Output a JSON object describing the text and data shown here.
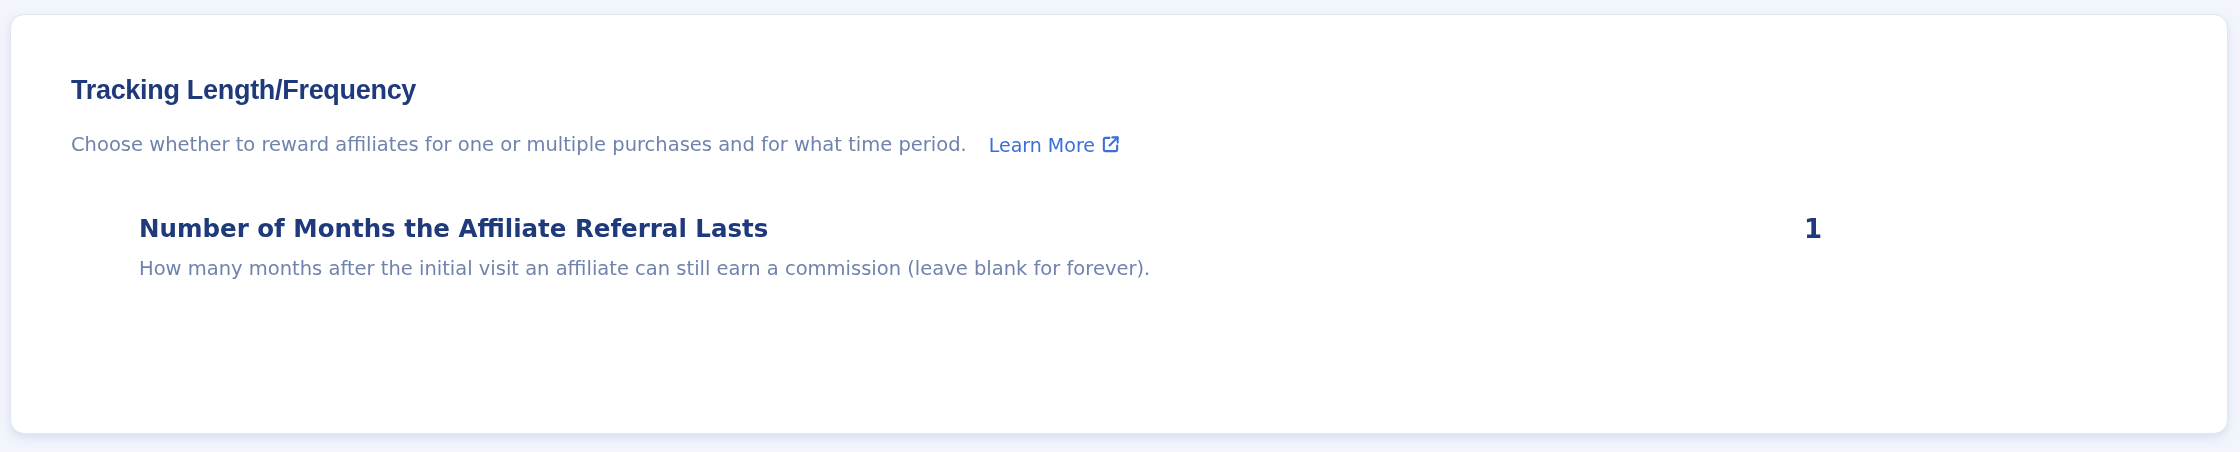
{
  "section": {
    "title": "Tracking Length/Frequency",
    "description": "Choose whether to reward affiliates for one or multiple purchases and for what time period.",
    "link": "Learn More"
  },
  "setting": {
    "label": "Number of Months the Affiliate Referral Lasts",
    "help": "How many months after the initial visit an affiliate can still earn a commission (leave blank for forever).",
    "value": "1"
  }
}
